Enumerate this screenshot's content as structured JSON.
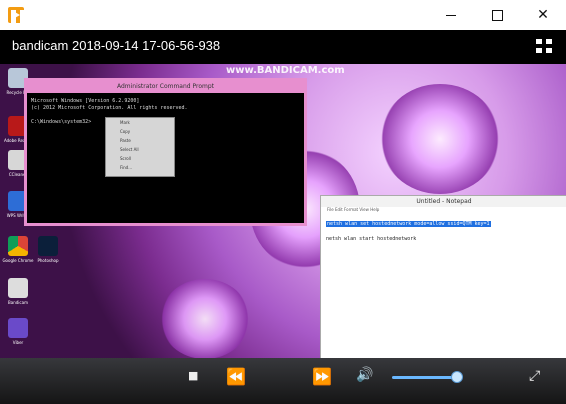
{
  "window": {
    "title": ""
  },
  "header": {
    "title": "bandicam 2018-09-14 17-06-56-938"
  },
  "video": {
    "watermark": "www.BANDICAM.com",
    "desktop_icons": [
      {
        "label": "Recycle Bin"
      },
      {
        "label": "Adobe Reader"
      },
      {
        "label": "CCleaner"
      },
      {
        "label": "WPS Writer"
      },
      {
        "label": "Google Chrome"
      },
      {
        "label": "Photoshop"
      },
      {
        "label": "Bandicam"
      },
      {
        "label": "Viber"
      }
    ],
    "cmd_window": {
      "title": "Administrator Command Prompt",
      "lines": [
        "Microsoft Windows [Version 6.2.9200]",
        "(c) 2012 Microsoft Corporation. All rights reserved.",
        "",
        "C:\\Windows\\system32>"
      ],
      "menu": [
        "Mark",
        "Copy",
        "Paste",
        "Select All",
        "Scroll",
        "Find..."
      ]
    },
    "notepad": {
      "title": "Untitled - Notepad",
      "menu": [
        "File",
        "Edit",
        "Format",
        "View",
        "Help"
      ],
      "selected_line": "netsh wlan set hostednetwork mode=allow ssid=QTM key=1",
      "plain_line": "netsh wlan start hostednetwork"
    }
  },
  "controls": {
    "stop": "■",
    "rewind": "⏪",
    "forward": "⏩",
    "volume": "🔊",
    "fullscreen": "⤢"
  }
}
